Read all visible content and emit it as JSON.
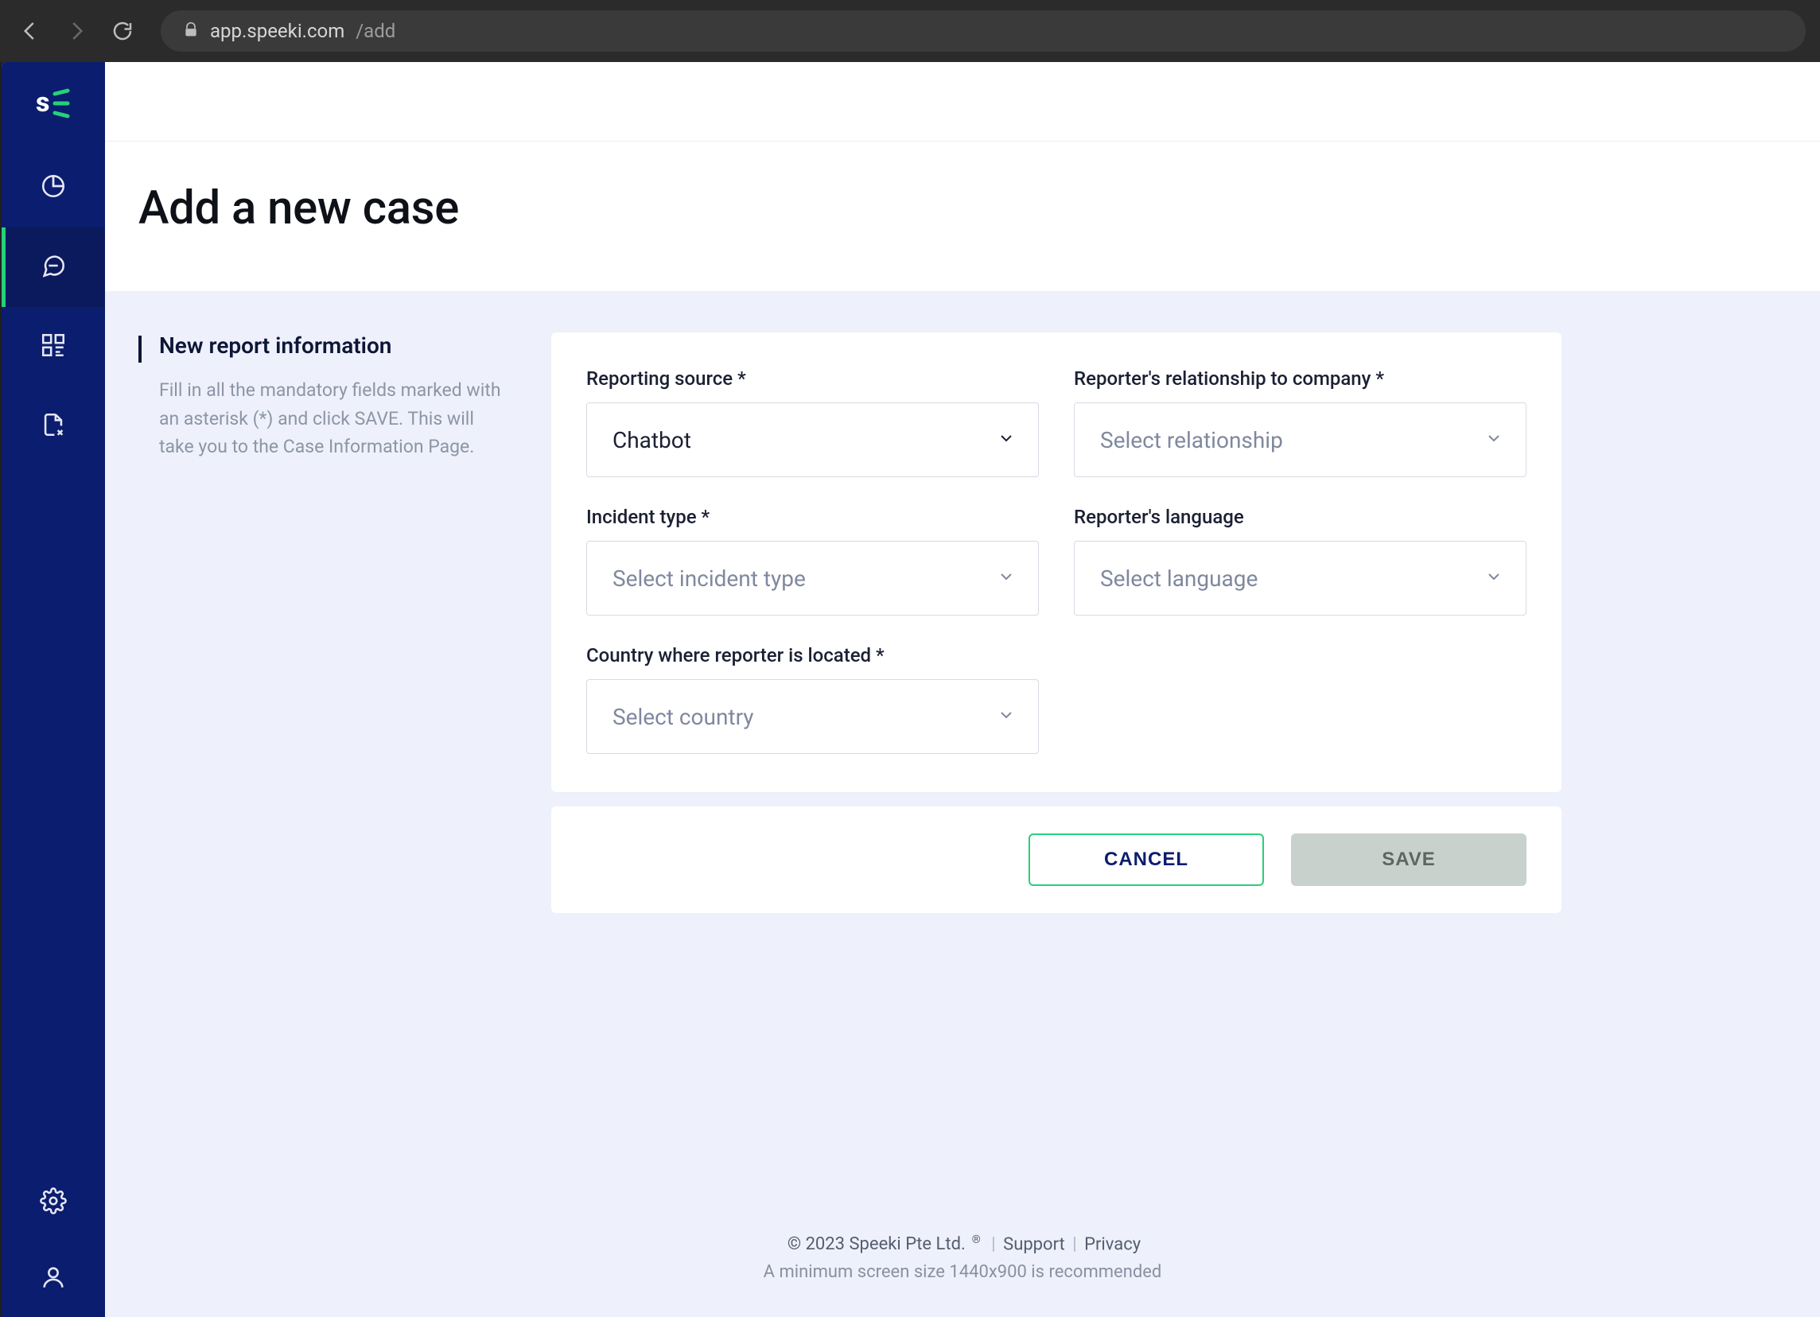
{
  "browser": {
    "url_host": "app.speeki.com",
    "url_path": "/add"
  },
  "page": {
    "title": "Add a new case"
  },
  "sideNote": {
    "heading": "New report information",
    "body": "Fill in all the mandatory fields marked with an asterisk (*) and click SAVE. This will take you to the Case Information Page."
  },
  "form": {
    "reportingSource": {
      "label": "Reporting source *",
      "value": "Chatbot"
    },
    "relationship": {
      "label": "Reporter's relationship to company *",
      "placeholder": "Select relationship"
    },
    "incidentType": {
      "label": "Incident type *",
      "placeholder": "Select incident type"
    },
    "language": {
      "label": "Reporter's language",
      "placeholder": "Select language"
    },
    "country": {
      "label": "Country where reporter is located *",
      "placeholder": "Select country"
    }
  },
  "actions": {
    "cancel": "CANCEL",
    "save": "SAVE"
  },
  "footer": {
    "copyright_prefix": "© 2023 Speeki Pte Ltd.",
    "reg": "®",
    "support": "Support",
    "privacy": "Privacy",
    "minsize": "A minimum screen size 1440x900 is recommended"
  }
}
